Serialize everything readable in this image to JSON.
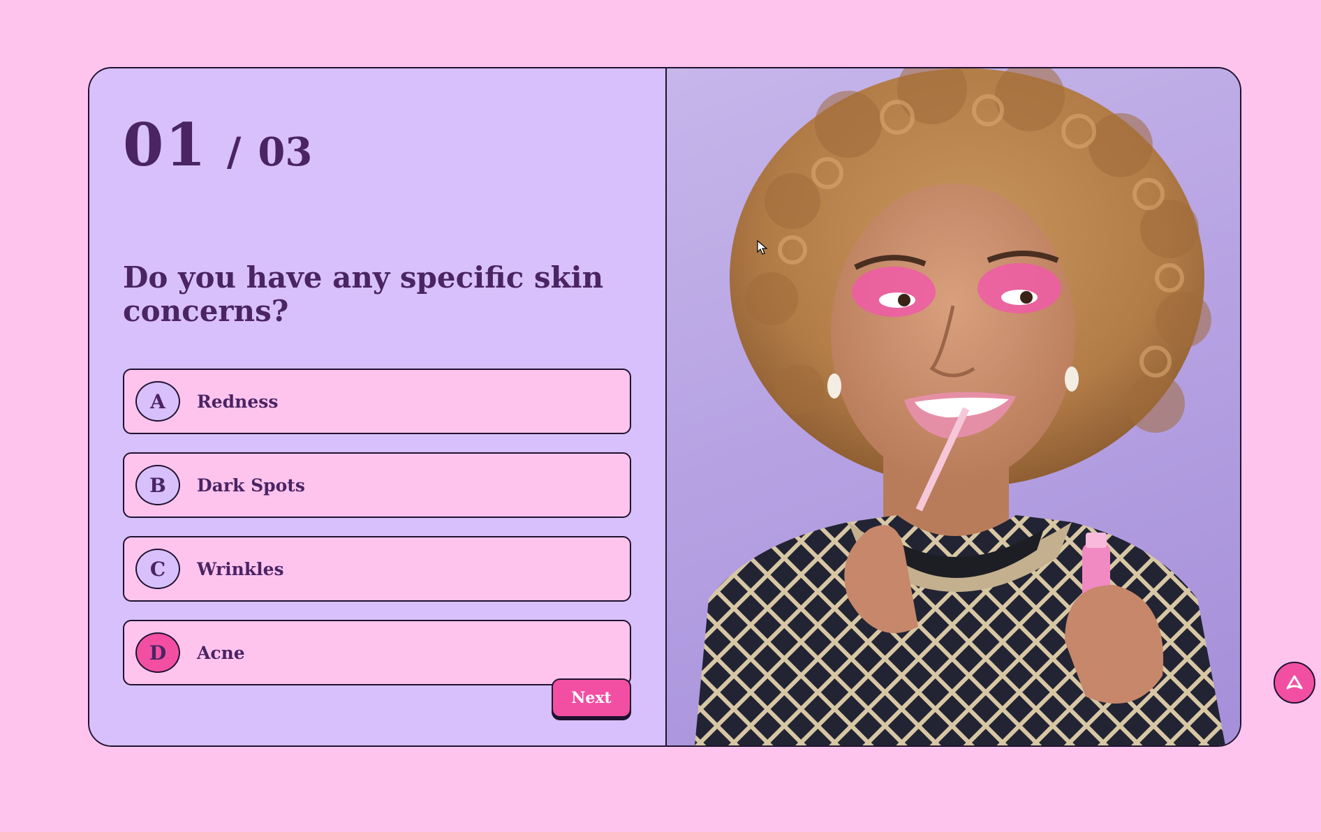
{
  "quiz": {
    "counter": {
      "current": "01",
      "separator": "/",
      "total": "03"
    },
    "question": "Do you have any specific skin concerns?",
    "options": [
      {
        "letter": "A",
        "label": "Redness",
        "selected": false
      },
      {
        "letter": "B",
        "label": "Dark Spots",
        "selected": false
      },
      {
        "letter": "C",
        "label": "Wrinkles",
        "selected": false
      },
      {
        "letter": "D",
        "label": "Acne",
        "selected": true
      }
    ],
    "next_label": "Next"
  },
  "icons": {
    "scroll_top": "chevron-up-icon",
    "cursor": "mouse-cursor-icon"
  },
  "colors": {
    "background": "#ffc4ee",
    "panel": "#d8c0fc",
    "accent": "#f24fa3",
    "text": "#4a2463",
    "border": "#1f1230"
  }
}
